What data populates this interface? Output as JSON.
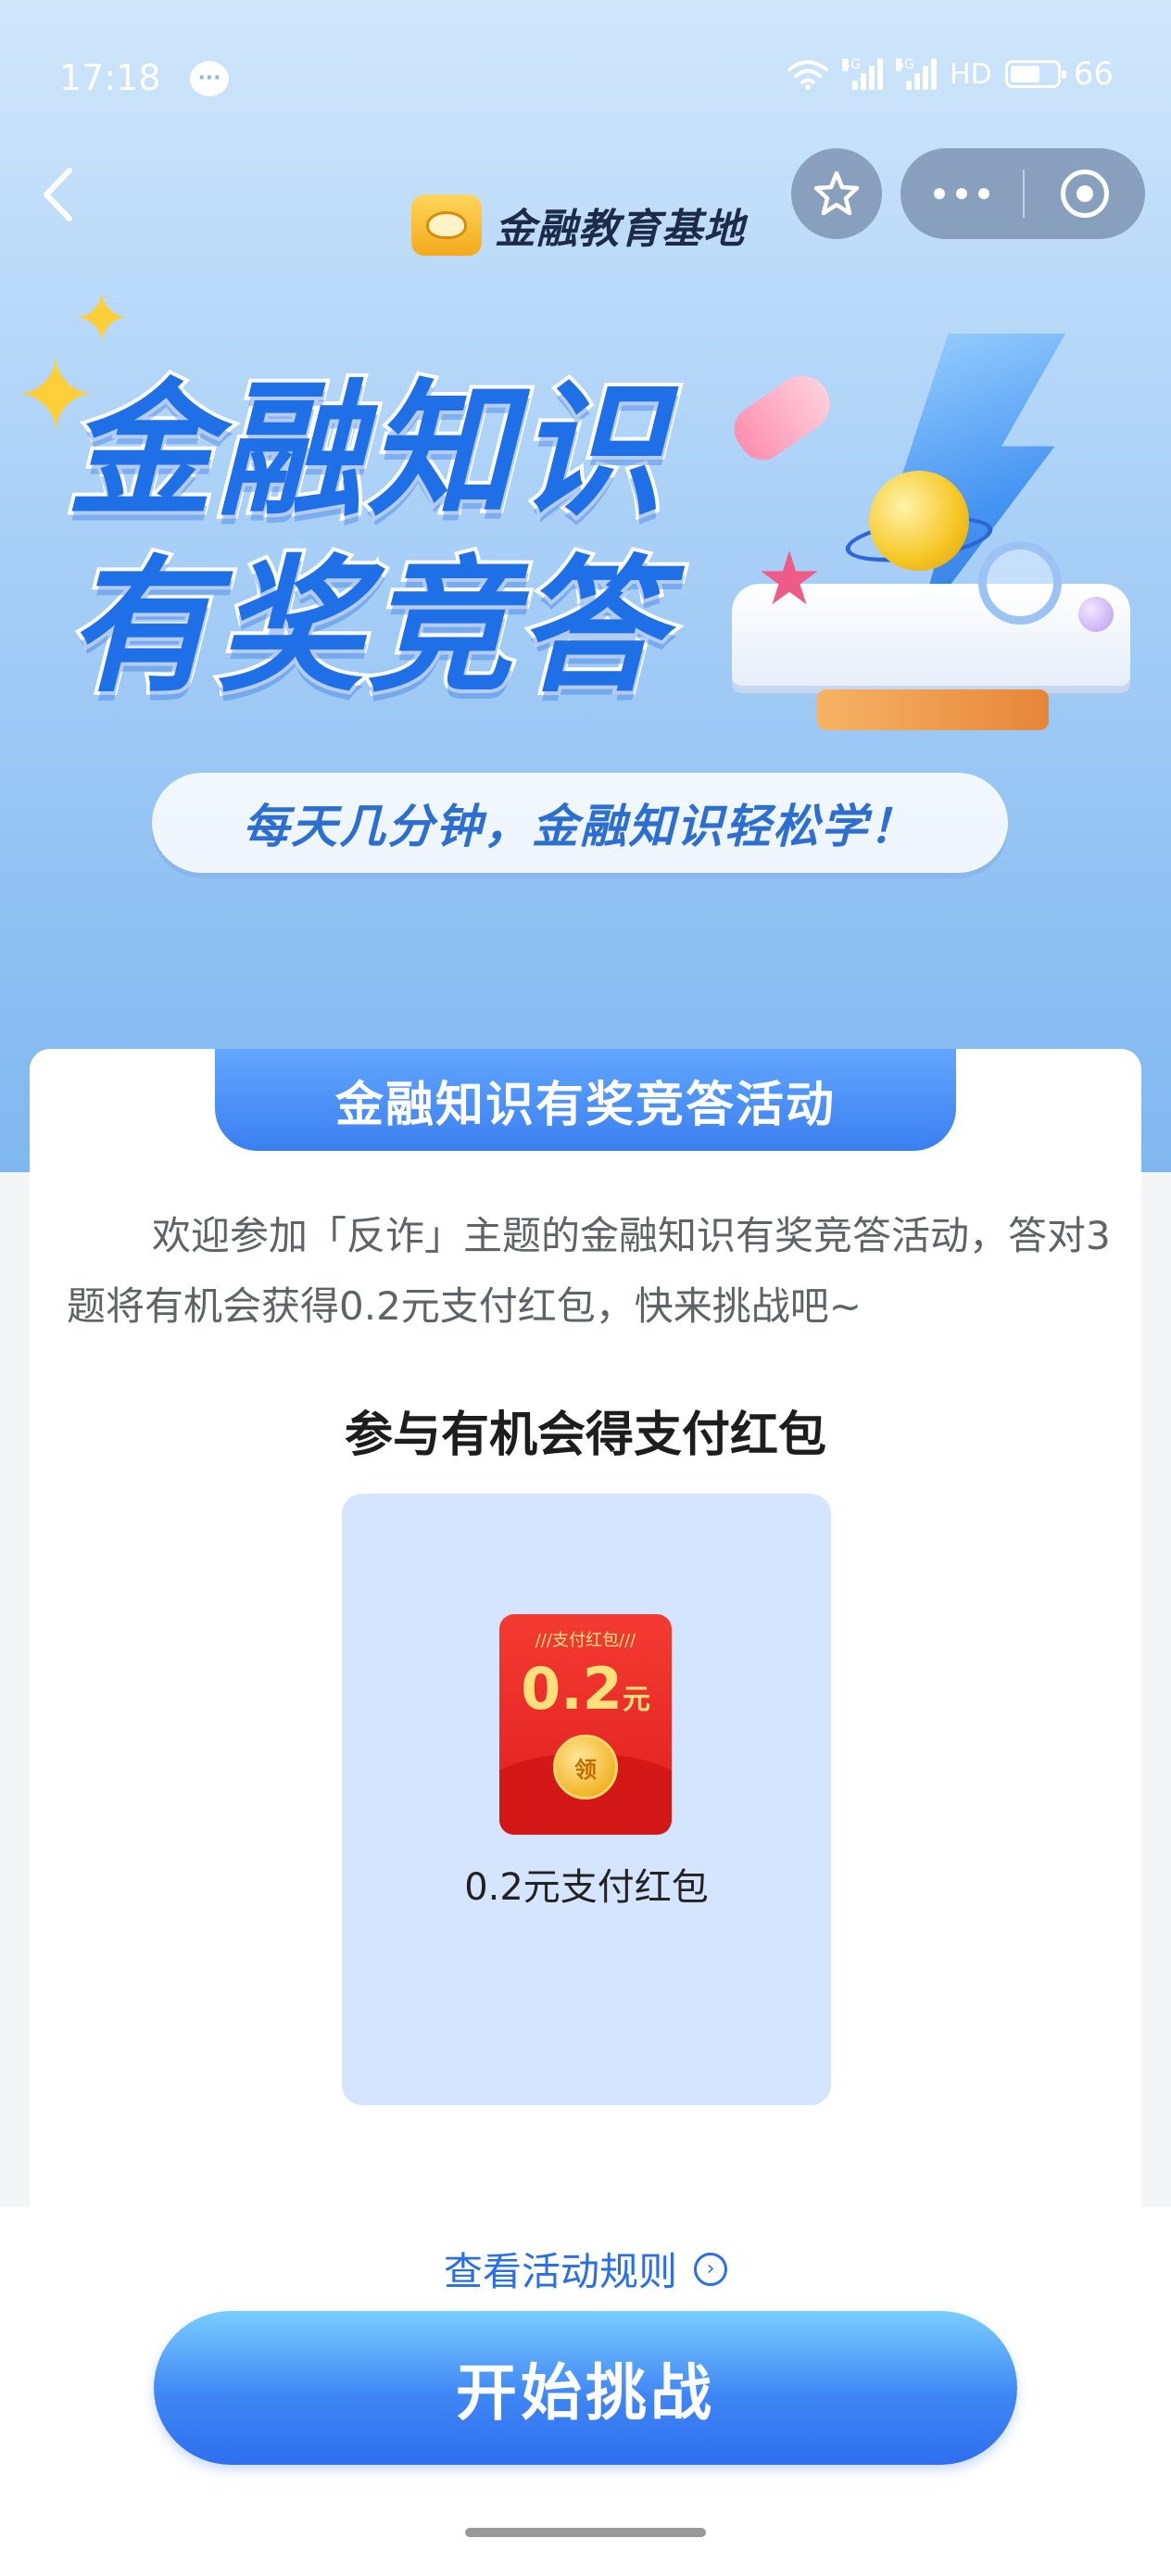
{
  "status_bar": {
    "time": "17:18",
    "signal_1_label": "4G",
    "signal_2_label": "5G",
    "hd_label": "HD",
    "battery_level": "66"
  },
  "brand": {
    "name": "金融教育基地"
  },
  "hero": {
    "title_line1": "金融知识",
    "title_line2": "有奖竞答",
    "slogan": "每天几分钟，金融知识轻松学！"
  },
  "card": {
    "banner_title": "金融知识有奖竞答活动",
    "intro_text": "欢迎参加「反诈」主题的金融知识有奖竞答活动，答对3题将有机会获得0.2元支付红包，快来挑战吧~",
    "prize_section_title": "参与有机会得支付红包",
    "prize": {
      "packet_header": "支付红包",
      "packet_amount": "0.2",
      "packet_unit": "元",
      "packet_coin_text": "领",
      "label": "0.2元支付红包"
    }
  },
  "footer": {
    "rules_link": "查看活动规则",
    "start_button": "开始挑战"
  },
  "colors": {
    "primary_blue": "#2a6fe6",
    "banner_blue": "#3a7ff0",
    "prize_bg": "#d5e5ff",
    "packet_red": "#e11e1e"
  },
  "icons": [
    "message-icon",
    "wifi-icon",
    "signal-icon",
    "battery-icon",
    "back-chevron-icon",
    "star-icon",
    "more-dots-icon",
    "close-target-icon",
    "brand-logo-icon",
    "chevron-right-circle-icon"
  ]
}
